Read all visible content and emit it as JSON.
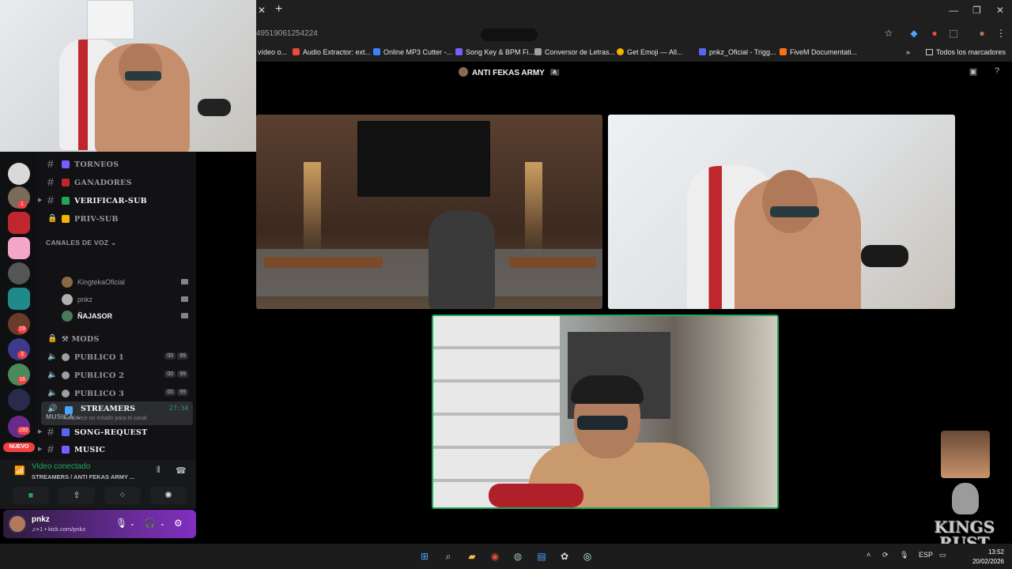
{
  "browser": {
    "url": "49519061254224",
    "bookmarks": [
      {
        "label": "vídeo o...",
        "color": "#555555"
      },
      {
        "label": "Audio Extractor: ext...",
        "color": "#e74c3c"
      },
      {
        "label": "Online MP3 Cutter -...",
        "color": "#3b82f6"
      },
      {
        "label": "Song Key & BPM Fi...",
        "color": "#7c5cff"
      },
      {
        "label": "Conversor de Letras...",
        "color": "#9aa0a6"
      },
      {
        "label": "Get Emoji — All...",
        "color": "#f4b400"
      },
      {
        "label": "pnkz_Oficial - Trigg...",
        "color": "#5865f2"
      },
      {
        "label": "FiveM Documentati...",
        "color": "#f97316"
      }
    ],
    "all_bookmarks": "Todos los marcadores"
  },
  "discord": {
    "header_channel": "ANTI FEKAS ARMY",
    "header_flag": "🏴‍☠️",
    "channels_top": [
      {
        "name": "TORNEOS",
        "emoji_color": "#7c5cff",
        "bright": false
      },
      {
        "name": "GANADORES",
        "emoji_color": "#c0272d",
        "bright": false
      },
      {
        "name": "VERIFICAR-SUB",
        "emoji_color": "#23a55a",
        "bright": true
      },
      {
        "name": "PRIV-SUB",
        "emoji_color": "#f4b400",
        "bright": false
      }
    ],
    "voice_category": "CANALES DE VOZ",
    "active_voice": {
      "name": "STREAMERS",
      "time": "27:34",
      "status": "Establece un estado para el canal"
    },
    "members": [
      {
        "name": "KingtekaOficial",
        "color": "#8a6a45",
        "bright": false
      },
      {
        "name": "pnkz",
        "color": "#b0b0b0",
        "bright": false
      },
      {
        "name": "ÑAJASOR",
        "color": "#4a7a5a",
        "bright": true
      }
    ],
    "mods_label": "MODS",
    "publicos": [
      {
        "name": "PUBLICO 1",
        "a": "00",
        "b": "99"
      },
      {
        "name": "PUBLICO 2",
        "a": "00",
        "b": "99"
      },
      {
        "name": "PUBLICO 3",
        "a": "00",
        "b": "99"
      }
    ],
    "music_category": "MUSICA",
    "music_channels": [
      {
        "name": "SONG-REQUEST",
        "emoji_color": "#5865f2"
      },
      {
        "name": "MUSIC",
        "emoji_color": "#7c5cff"
      }
    ],
    "server_badges": [
      "1",
      "19",
      "3",
      "16",
      "192"
    ],
    "nuevo": "NUEVO",
    "voice_panel": {
      "status": "Video conectado",
      "sub": "STREAMERS / ANTI FEKAS ARMY ..."
    },
    "user": {
      "name": "pnkz",
      "status": "♫+1 • kick.com/pnkz"
    }
  },
  "overlay": {
    "logo_text_1": "KINGS",
    "logo_text_2": "RUST"
  },
  "taskbar": {
    "lang": "ESP",
    "time": "13:52",
    "date": "20/02/2026"
  }
}
